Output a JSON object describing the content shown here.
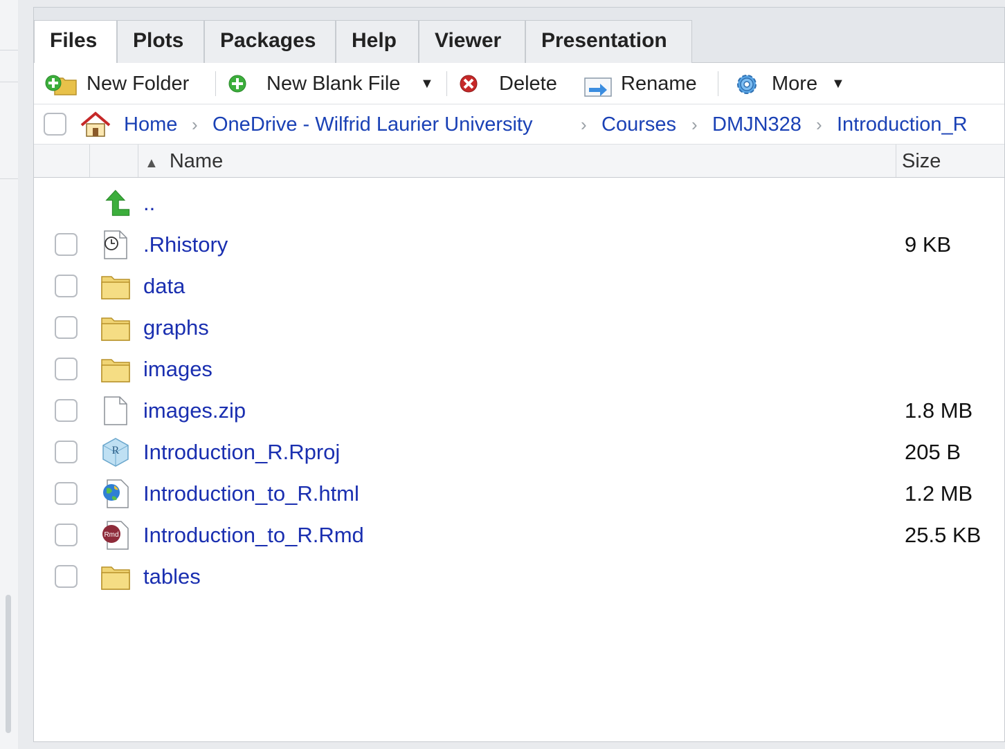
{
  "tabs": [
    "Files",
    "Plots",
    "Packages",
    "Help",
    "Viewer",
    "Presentation"
  ],
  "toolbar": {
    "new_folder": "New Folder",
    "new_blank_file": "New Blank File",
    "delete": "Delete",
    "rename": "Rename",
    "more": "More"
  },
  "breadcrumb": [
    "Home",
    "OneDrive - Wilfrid Laurier University",
    "Courses",
    "DMJN328",
    "Introduction_R"
  ],
  "table": {
    "name_header": "Name",
    "size_header": "Size",
    "parent_label": ".."
  },
  "files": [
    {
      "name": ".Rhistory",
      "size": "9 KB",
      "icon": "rhistory-icon"
    },
    {
      "name": "data",
      "size": "",
      "icon": "folder-icon"
    },
    {
      "name": "graphs",
      "size": "",
      "icon": "folder-icon"
    },
    {
      "name": "images",
      "size": "",
      "icon": "folder-icon"
    },
    {
      "name": "images.zip",
      "size": "1.8 MB",
      "icon": "file-icon"
    },
    {
      "name": "Introduction_R.Rproj",
      "size": "205 B",
      "icon": "rproj-icon"
    },
    {
      "name": "Introduction_to_R.html",
      "size": "1.2 MB",
      "icon": "html-icon"
    },
    {
      "name": "Introduction_to_R.Rmd",
      "size": "25.5 KB",
      "icon": "rmd-icon"
    },
    {
      "name": "tables",
      "size": "",
      "icon": "folder-icon"
    }
  ],
  "colors": {
    "link": "#1a2fb0",
    "accent_green": "#3cae3c",
    "delete_red": "#c62828"
  }
}
